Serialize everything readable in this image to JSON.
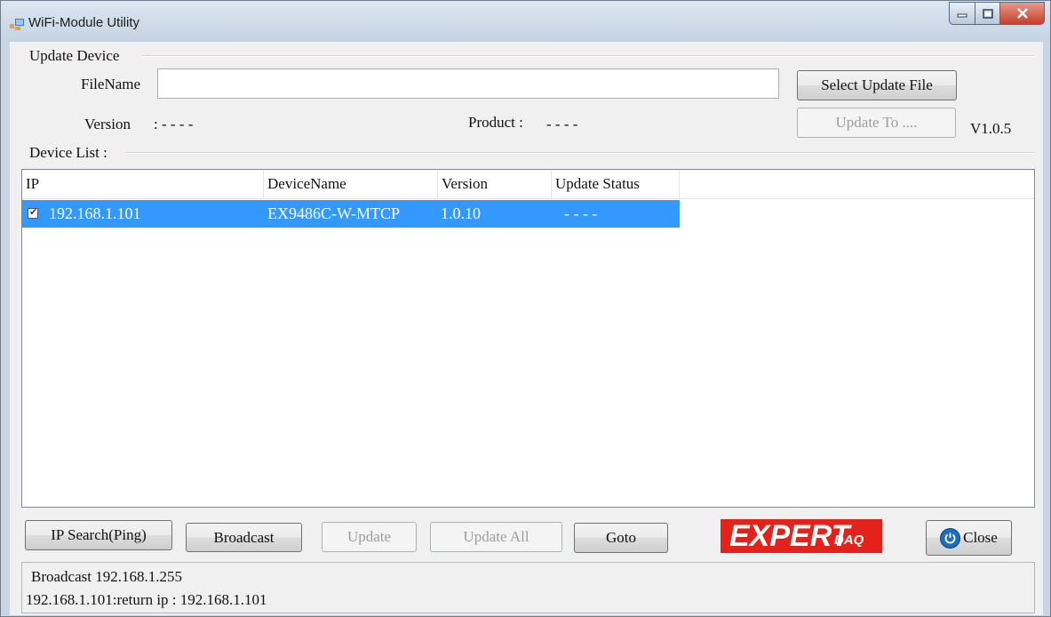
{
  "window": {
    "title": "WiFi-Module Utility",
    "icon": "app-window-icon"
  },
  "update_device": {
    "group_label": "Update Device",
    "filename_label": "FileName",
    "filename_value": "",
    "select_file_button": "Select Update File",
    "version_label": "Version",
    "version_value": ": - - - -",
    "product_label": "Product :",
    "product_value": "- - - -",
    "update_to_button": "Update To ....",
    "app_version": "V1.0.5"
  },
  "device_list": {
    "group_label": "Device List :",
    "columns": [
      "IP",
      "DeviceName",
      "Version",
      "Update Status"
    ],
    "rows": [
      {
        "checked": true,
        "ip": "192.168.1.101",
        "device_name": "EX9486C-W-MTCP",
        "version": "1.0.10",
        "update_status": "- - - -"
      }
    ]
  },
  "buttons": {
    "ip_search": "IP Search(Ping)",
    "broadcast": "Broadcast",
    "update": "Update",
    "update_all": "Update All",
    "goto": "Goto",
    "close": "Close"
  },
  "logo": {
    "text": "EXPERT",
    "sub": "DAQ"
  },
  "status_log": [
    "Broadcast 192.168.1.255",
    "192.168.1.101:return  ip : 192.168.1.101"
  ],
  "colors": {
    "selection": "#3399ff",
    "logo_red": "#e3221b",
    "title_bar": "#c6d3e2"
  }
}
